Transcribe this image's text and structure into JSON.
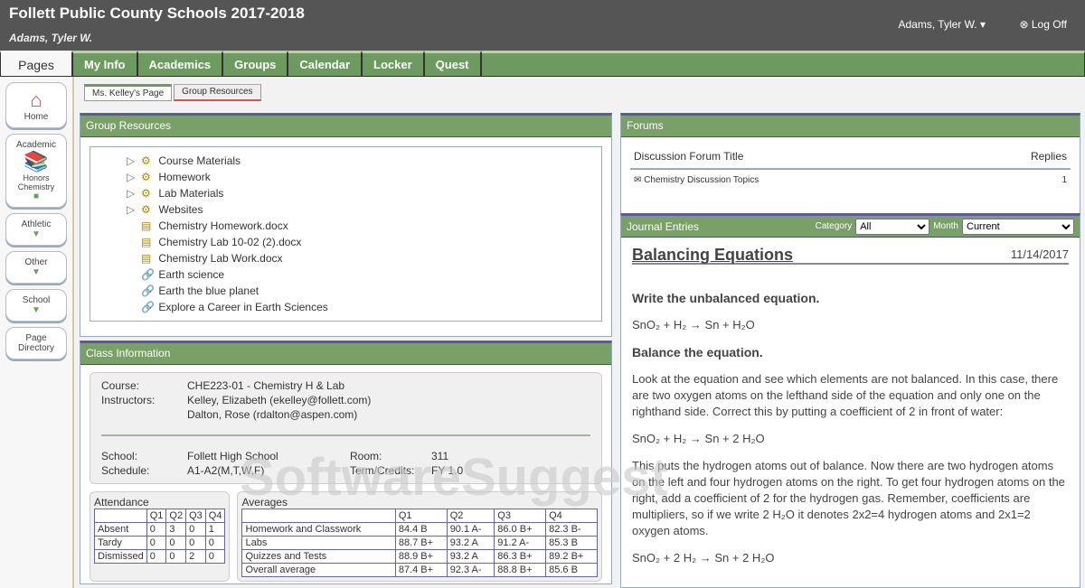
{
  "header": {
    "title": "Follett Public County Schools 2017-2018",
    "student": "Adams, Tyler W.",
    "user_menu": "Adams, Tyler W. ▾",
    "logoff": "Log Off"
  },
  "tabs": [
    "Pages",
    "My Info",
    "Academics",
    "Groups",
    "Calendar",
    "Locker",
    "Quest"
  ],
  "sidebar": [
    {
      "label": "Home",
      "icon": "house-icon"
    },
    {
      "label": "Academic",
      "sub": "Honors Chemistry",
      "icon": "books-icon"
    },
    {
      "label": "Athletic"
    },
    {
      "label": "Other"
    },
    {
      "label": "School"
    },
    {
      "label": "Page Directory"
    }
  ],
  "subtabs": [
    "Ms. Kelley's Page",
    "Group Resources"
  ],
  "group_resources": {
    "title": "Group Resources",
    "items": [
      {
        "label": "Course Materials",
        "type": "folder"
      },
      {
        "label": "Homework",
        "type": "folder"
      },
      {
        "label": "Lab Materials",
        "type": "folder"
      },
      {
        "label": "Websites",
        "type": "folder"
      },
      {
        "label": "Chemistry Homework.docx",
        "type": "file"
      },
      {
        "label": "Chemistry Lab 10-02 (2).docx",
        "type": "file"
      },
      {
        "label": "Chemistry Lab Work.docx",
        "type": "file"
      },
      {
        "label": "Earth science",
        "type": "link"
      },
      {
        "label": "Earth the blue planet",
        "type": "link"
      },
      {
        "label": "Explore a Career in Earth Sciences",
        "type": "link"
      }
    ]
  },
  "class_info": {
    "title": "Class Information",
    "course_label": "Course:",
    "course": "CHE223-01 - Chemistry H & Lab",
    "instructor_label": "Instructors:",
    "instructors": [
      "Kelley, Elizabeth (ekelley@follett.com)",
      "Dalton, Rose (rdalton@aspen.com)"
    ],
    "school_label": "School:",
    "school": "Follett High School",
    "room_label": "Room:",
    "room": "311",
    "schedule_label": "Schedule:",
    "schedule": "A1-A2(M,T,W,F)",
    "term_label": "Term/Credits:",
    "term": "FY 1.0",
    "attendance": {
      "title": "Attendance",
      "cols": [
        "Q1",
        "Q2",
        "Q3",
        "Q4"
      ],
      "rows": [
        {
          "name": "Absent",
          "v": [
            "0",
            "3",
            "0",
            "1"
          ]
        },
        {
          "name": "Tardy",
          "v": [
            "0",
            "0",
            "0",
            "0"
          ]
        },
        {
          "name": "Dismissed",
          "v": [
            "0",
            "0",
            "2",
            "0"
          ]
        }
      ]
    },
    "averages": {
      "title": "Averages",
      "cols": [
        "Q1",
        "Q2",
        "Q3",
        "Q4"
      ],
      "rows": [
        {
          "name": "Homework and Classwork",
          "v": [
            "84.4 B",
            "90.1 A-",
            "86.0 B+",
            "82.3 B-"
          ]
        },
        {
          "name": "Labs",
          "v": [
            "88.7 B+",
            "93.2 A",
            "91.2 A-",
            "85.3 B"
          ]
        },
        {
          "name": "Quizzes and Tests",
          "v": [
            "88.9 B+",
            "93.2 A",
            "86.3 B+",
            "89.2 B+"
          ]
        },
        {
          "name": "Overall average",
          "v": [
            "87.4 B+",
            "92.3 A-",
            "88.8 B+",
            "85.6 B"
          ]
        }
      ]
    }
  },
  "forums": {
    "title": "Forums",
    "col_title": "Discussion Forum Title",
    "col_replies": "Replies",
    "rows": [
      {
        "title": "Chemistry Discussion Topics",
        "replies": "1"
      }
    ]
  },
  "journal": {
    "title": "Journal Entries",
    "category_label": "Category",
    "category": "All",
    "month_label": "Month",
    "month": "Current",
    "entry_title": "Balancing Equations",
    "entry_date": "11/14/2017",
    "h1": "Write the unbalanced equation.",
    "eq1": "SnO₂ + H₂ → Sn + H₂O",
    "h2": "Balance the equation.",
    "p1": "Look at the equation and see which elements are not balanced. In this case, there are two oxygen atoms on the lefthand side of the equation and only one on the righthand side. Correct this by putting a coefficient of 2 in front of water:",
    "eq2": "SnO₂ + H₂ → Sn + 2 H₂O",
    "p2": "This puts the hydrogen atoms out of balance. Now there are two hydrogen atoms on the left and four hydrogen atoms on the right. To get four hydrogen atoms on the right, add a coefficient of 2 for the hydrogen gas. Remember, coefficients are multipliers, so if we write 2 H₂O it denotes 2x2=4 hydrogen atoms and 2x1=2 oxygen atoms.",
    "eq3": "SnO₂ + 2 H₂ → Sn + 2 H₂O"
  },
  "watermark": "SoftwareSuggest"
}
